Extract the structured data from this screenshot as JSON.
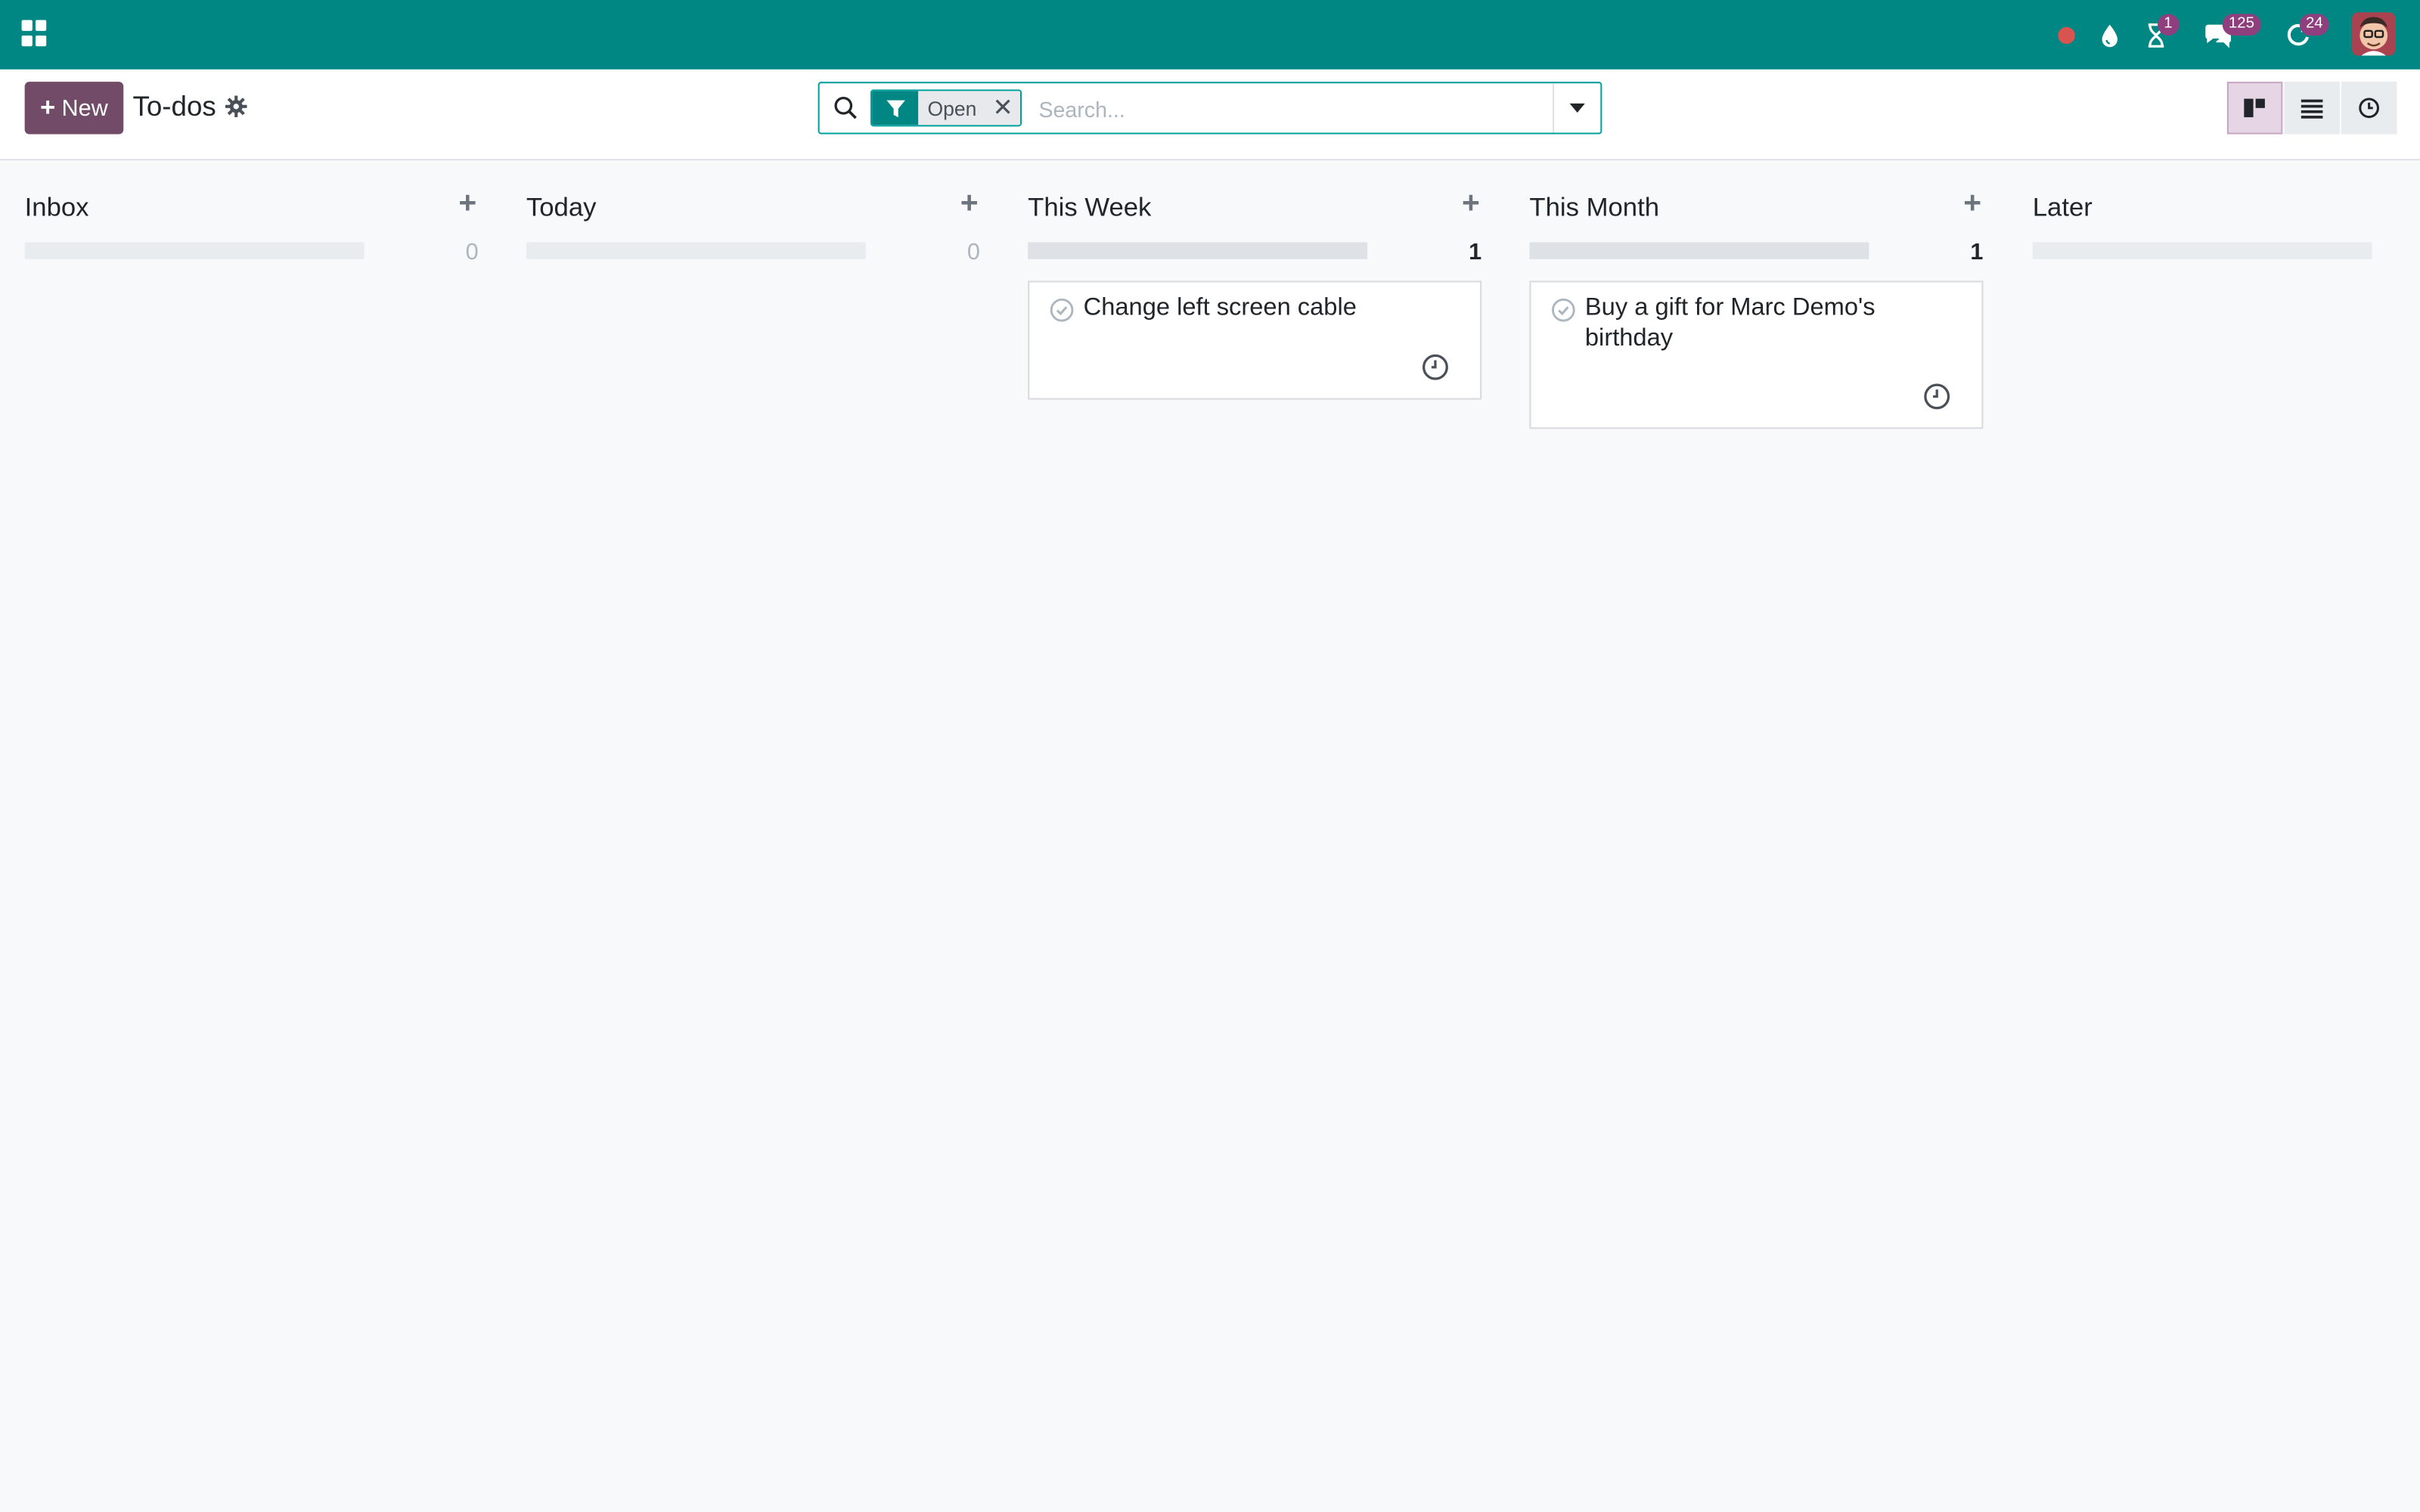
{
  "navbar": {
    "badges": {
      "activities": "1",
      "messages": "125",
      "updates": "24"
    },
    "icons": [
      "apps-icon",
      "record-dot-icon",
      "droplet-icon",
      "hourglass-icon",
      "chat-icon",
      "refresh-icon"
    ],
    "colors": {
      "background": "#008784",
      "badge": "#8f3f7e",
      "record_dot": "#d9534f"
    }
  },
  "control_panel": {
    "new_label": "New",
    "title": "To-dos",
    "search": {
      "facet_label": "Open",
      "placeholder": "Search..."
    },
    "views": [
      "kanban",
      "list",
      "activity"
    ],
    "active_view": "kanban"
  },
  "kanban": {
    "columns": [
      {
        "title": "Inbox",
        "count": "0",
        "cards": []
      },
      {
        "title": "Today",
        "count": "0",
        "cards": []
      },
      {
        "title": "This Week",
        "count": "1",
        "cards": [
          {
            "title": "Change left screen cable"
          }
        ]
      },
      {
        "title": "This Month",
        "count": "1",
        "cards": [
          {
            "title": "Buy a gift for Marc Demo's birthday"
          }
        ]
      },
      {
        "title": "Later",
        "count": "",
        "cards": []
      }
    ]
  },
  "accent_colors": {
    "primary": "#714b67",
    "teal": "#008784"
  }
}
